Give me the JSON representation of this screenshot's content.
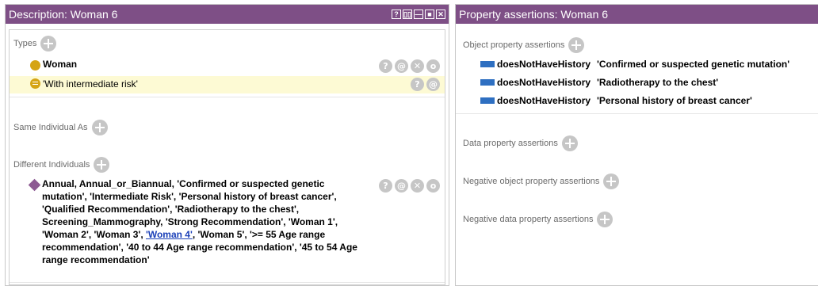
{
  "left": {
    "title": "Description: Woman 6",
    "controls": [
      "?",
      "▯▯",
      "—",
      "■",
      "✕"
    ],
    "types_label": "Types",
    "types": [
      {
        "label": "Woman"
      },
      {
        "label": "'With intermediate risk'"
      }
    ],
    "same_label": "Same Individual As",
    "different_label": "Different Individuals",
    "different_text_before": "Annual, Annual_or_Biannual, 'Confirmed or suspected genetic mutation', 'Intermediate Risk', 'Personal history of breast cancer', 'Qualified Recommendation', 'Radiotherapy to the chest', Screening_Mammography, 'Strong Recommendation', 'Woman 1', 'Woman 2', 'Woman 3', ",
    "different_link": "'Woman 4'",
    "different_text_after": ", 'Woman 5', '>= 55 Age range recommendation', '40 to 44 Age range recommendation', '45 to 54 Age range recommendation'",
    "action_glyphs": {
      "help": "?",
      "annotate": "@",
      "delete": "✕",
      "edit": "o"
    }
  },
  "right": {
    "title": "Property assertions: Woman 6",
    "object_label": "Object property assertions",
    "assertions": [
      {
        "property": "doesNotHaveHistory",
        "value": "'Confirmed or suspected genetic mutation'"
      },
      {
        "property": "doesNotHaveHistory",
        "value": "'Radiotherapy to the chest'"
      },
      {
        "property": "doesNotHaveHistory",
        "value": "'Personal history of breast cancer'"
      }
    ],
    "data_label": "Data property assertions",
    "neg_object_label": "Negative object property assertions",
    "neg_data_label": "Negative data property assertions"
  },
  "colors": {
    "titlebar": "#7e4f86",
    "highlight": "#fdfad4",
    "class_icon": "#d5a415",
    "property_icon": "#2e6fc1",
    "individual_icon": "#8d5a93"
  }
}
